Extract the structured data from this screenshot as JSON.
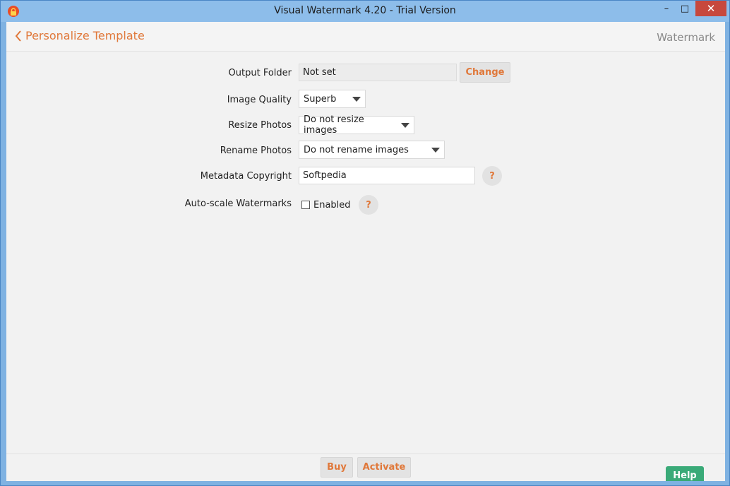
{
  "window": {
    "title": "Visual Watermark 4.20 - Trial Version",
    "minimize_glyph": "–",
    "maximize_glyph": "□",
    "close_glyph": "✕"
  },
  "topbar": {
    "back_label": "Personalize Template",
    "section_label": "Watermark"
  },
  "form": {
    "output_folder": {
      "label": "Output Folder",
      "value": "Not set",
      "button_label": "Change"
    },
    "image_quality": {
      "label": "Image Quality",
      "selected": "Superb"
    },
    "resize_photos": {
      "label": "Resize Photos",
      "selected": "Do not resize images"
    },
    "rename_photos": {
      "label": "Rename Photos",
      "selected": "Do not rename images"
    },
    "metadata_copyright": {
      "label": "Metadata Copyright",
      "value": "Softpedia",
      "help_glyph": "?"
    },
    "auto_scale": {
      "label": "Auto-scale Watermarks",
      "checkbox_label": "Enabled",
      "checked": false,
      "help_glyph": "?"
    }
  },
  "footer": {
    "buy_label": "Buy",
    "activate_label": "Activate",
    "help_label": "Help"
  },
  "colors": {
    "accent": "#e0783a",
    "help_button": "#3aaa78",
    "close_button": "#c7483d",
    "title_bar": "#8dbdea"
  },
  "icons": {
    "app": "lock-icon",
    "back": "chevron-left-icon",
    "dropdown": "caret-down-icon"
  }
}
